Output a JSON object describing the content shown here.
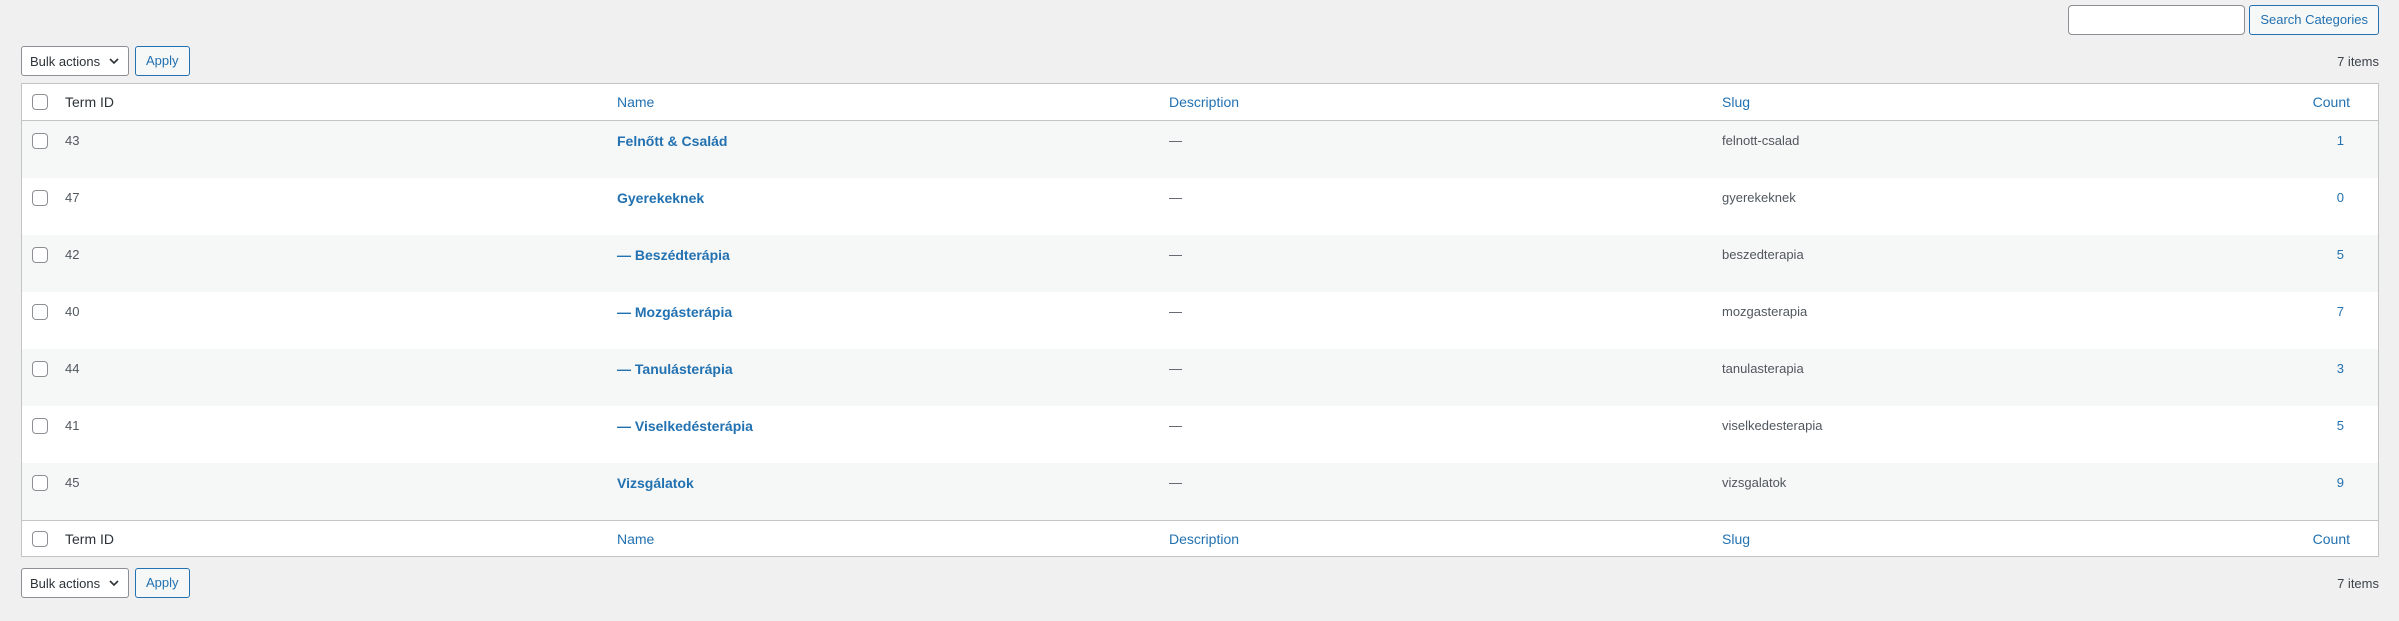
{
  "search": {
    "placeholder": "",
    "button_label": "Search Categories"
  },
  "tablenav_top": {
    "bulk_label": "Bulk actions",
    "apply_label": "Apply",
    "items_count": "7 items"
  },
  "tablenav_bottom": {
    "bulk_label": "Bulk actions",
    "apply_label": "Apply",
    "items_count": "7 items"
  },
  "columns": {
    "term_id": "Term ID",
    "name": "Name",
    "description": "Description",
    "slug": "Slug",
    "count": "Count"
  },
  "rows": [
    {
      "id": "43",
      "name": "Felnőtt & Család",
      "description": "—",
      "slug": "felnott-csalad",
      "count": "1"
    },
    {
      "id": "47",
      "name": "Gyerekeknek",
      "description": "—",
      "slug": "gyerekeknek",
      "count": "0"
    },
    {
      "id": "42",
      "name": "— Beszédterápia",
      "description": "—",
      "slug": "beszedterapia",
      "count": "5"
    },
    {
      "id": "40",
      "name": "— Mozgásterápia",
      "description": "—",
      "slug": "mozgasterapia",
      "count": "7"
    },
    {
      "id": "44",
      "name": "— Tanulásterápia",
      "description": "—",
      "slug": "tanulasterapia",
      "count": "3"
    },
    {
      "id": "41",
      "name": "— Viselkedésterápia",
      "description": "—",
      "slug": "viselkedesterapia",
      "count": "5"
    },
    {
      "id": "45",
      "name": "Vizsgálatok",
      "description": "—",
      "slug": "vizsgalatok",
      "count": "9"
    }
  ],
  "colors": {
    "accent": "#2271b1",
    "background": "#f0f0f1",
    "row_alt": "#f6f7f7",
    "border": "#c3c4c7"
  },
  "icons": {
    "dropdown": "chevron-down-icon"
  }
}
